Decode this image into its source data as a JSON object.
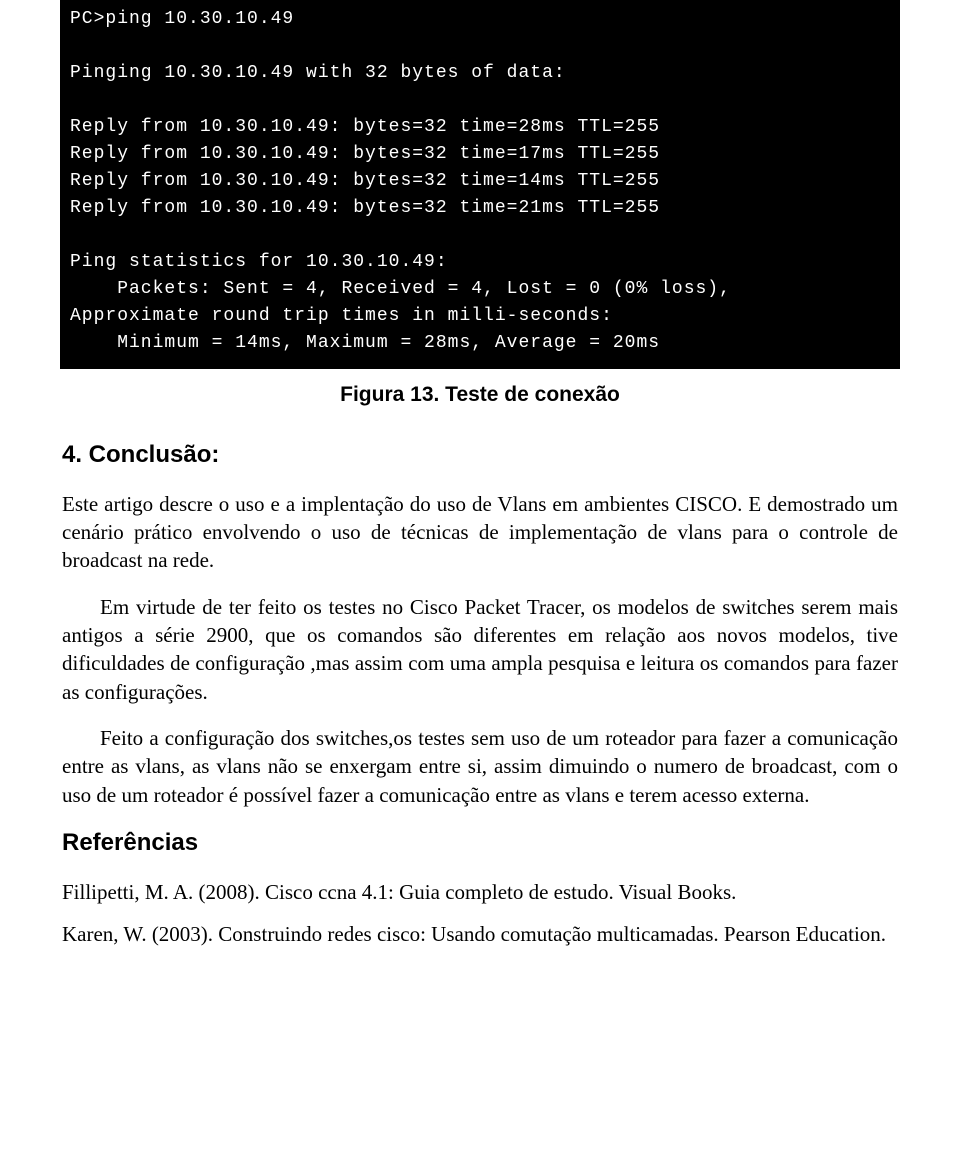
{
  "terminal": {
    "line1": "PC>ping 10.30.10.49",
    "blank1": "",
    "line2": "Pinging 10.30.10.49 with 32 bytes of data:",
    "blank2": "",
    "reply1": "Reply from 10.30.10.49: bytes=32 time=28ms TTL=255",
    "reply2": "Reply from 10.30.10.49: bytes=32 time=17ms TTL=255",
    "reply3": "Reply from 10.30.10.49: bytes=32 time=14ms TTL=255",
    "reply4": "Reply from 10.30.10.49: bytes=32 time=21ms TTL=255",
    "blank3": "",
    "stats1": "Ping statistics for 10.30.10.49:",
    "stats2": "    Packets: Sent = 4, Received = 4, Lost = 0 (0% loss),",
    "stats3": "Approximate round trip times in milli-seconds:",
    "stats4": "    Minimum = 14ms, Maximum = 28ms, Average = 20ms"
  },
  "caption": "Figura 13. Teste de conexão",
  "section_conclusion": {
    "heading": "4. Conclusão:",
    "p1": "Este artigo descre o uso e a implentação do uso de Vlans em ambientes CISCO. E demostrado um cenário prático envolvendo o uso de técnicas de implementação de vlans para o controle de broadcast na rede.",
    "p2": "Em virtude de ter feito os testes no Cisco Packet Tracer, os modelos de switches serem mais antigos a série 2900, que os comandos são diferentes em relação aos novos modelos, tive dificuldades de configuração ,mas assim com uma ampla pesquisa e leitura os comandos para fazer as configurações.",
    "p3": "Feito a configuração dos switches,os testes sem uso de um roteador para fazer a comunicação entre as vlans, as vlans não se enxergam entre si, assim dimuindo o numero de broadcast, com o uso de um roteador é possível fazer a comunicação entre as vlans e terem acesso externa."
  },
  "references": {
    "heading": "Referências",
    "r1": "Fillipetti, M. A. (2008). Cisco ccna 4.1: Guia completo de estudo. Visual Books.",
    "r2": "Karen, W. (2003). Construindo redes cisco: Usando comutação multicamadas. Pearson Education."
  }
}
